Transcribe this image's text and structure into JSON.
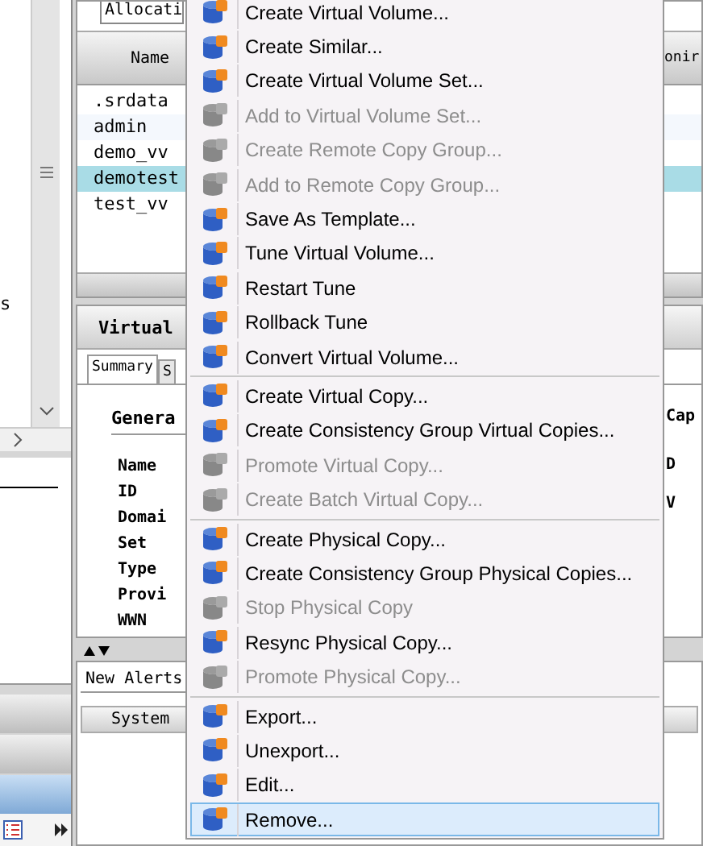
{
  "left_pane": {
    "label": "s"
  },
  "toolbar": {
    "dropdown": "Allocati"
  },
  "table": {
    "columns": [
      "Name",
      "onir"
    ],
    "rows": [
      {
        "name": ".srdata",
        "selected": false
      },
      {
        "name": "admin",
        "selected": false
      },
      {
        "name": "demo_vv",
        "selected": false
      },
      {
        "name": "demotest",
        "selected": true
      },
      {
        "name": "test_vv",
        "selected": false
      }
    ]
  },
  "detail": {
    "title": "Virtual",
    "tabs": [
      {
        "label": "Summary",
        "selected": true
      },
      {
        "label": "S",
        "selected": false
      }
    ],
    "section": "Genera",
    "side_heading": "Cap",
    "fields": [
      "Name",
      "ID",
      "Domai",
      "Set",
      "Type",
      "Provi",
      "WWN"
    ],
    "side_fields": [
      "D",
      "V"
    ]
  },
  "alerts": {
    "tab": "New Alerts",
    "columns": [
      "System"
    ]
  },
  "context_menu": [
    {
      "kind": "item",
      "label": "Create Virtual Volume...",
      "disabled": false,
      "selected": false
    },
    {
      "kind": "item",
      "label": "Create Similar...",
      "disabled": false,
      "selected": false
    },
    {
      "kind": "item",
      "label": "Create Virtual Volume Set...",
      "disabled": false,
      "selected": false
    },
    {
      "kind": "item",
      "label": "Add to Virtual Volume Set...",
      "disabled": true,
      "selected": false
    },
    {
      "kind": "item",
      "label": "Create Remote Copy Group...",
      "disabled": true,
      "selected": false
    },
    {
      "kind": "item",
      "label": "Add to Remote Copy Group...",
      "disabled": true,
      "selected": false
    },
    {
      "kind": "item",
      "label": "Save As Template...",
      "disabled": false,
      "selected": false
    },
    {
      "kind": "item",
      "label": "Tune Virtual Volume...",
      "disabled": false,
      "selected": false
    },
    {
      "kind": "item",
      "label": "Restart Tune",
      "disabled": false,
      "selected": false
    },
    {
      "kind": "item",
      "label": "Rollback Tune",
      "disabled": false,
      "selected": false
    },
    {
      "kind": "item",
      "label": "Convert Virtual Volume...",
      "disabled": false,
      "selected": false
    },
    {
      "kind": "separator"
    },
    {
      "kind": "item",
      "label": "Create Virtual Copy...",
      "disabled": false,
      "selected": false
    },
    {
      "kind": "item",
      "label": "Create Consistency Group Virtual Copies...",
      "disabled": false,
      "selected": false
    },
    {
      "kind": "item",
      "label": "Promote Virtual Copy...",
      "disabled": true,
      "selected": false
    },
    {
      "kind": "item",
      "label": "Create Batch Virtual Copy...",
      "disabled": true,
      "selected": false
    },
    {
      "kind": "separator"
    },
    {
      "kind": "item",
      "label": "Create Physical Copy...",
      "disabled": false,
      "selected": false
    },
    {
      "kind": "item",
      "label": "Create Consistency Group Physical Copies...",
      "disabled": false,
      "selected": false
    },
    {
      "kind": "item",
      "label": "Stop Physical Copy",
      "disabled": true,
      "selected": false
    },
    {
      "kind": "item",
      "label": "Resync Physical Copy...",
      "disabled": false,
      "selected": false
    },
    {
      "kind": "item",
      "label": "Promote Physical Copy...",
      "disabled": true,
      "selected": false
    },
    {
      "kind": "separator"
    },
    {
      "kind": "item",
      "label": "Export...",
      "disabled": false,
      "selected": false
    },
    {
      "kind": "item",
      "label": "Unexport...",
      "disabled": false,
      "selected": false
    },
    {
      "kind": "item",
      "label": "Edit...",
      "disabled": false,
      "selected": false
    },
    {
      "kind": "item",
      "label": "Remove...",
      "disabled": false,
      "selected": true
    }
  ]
}
